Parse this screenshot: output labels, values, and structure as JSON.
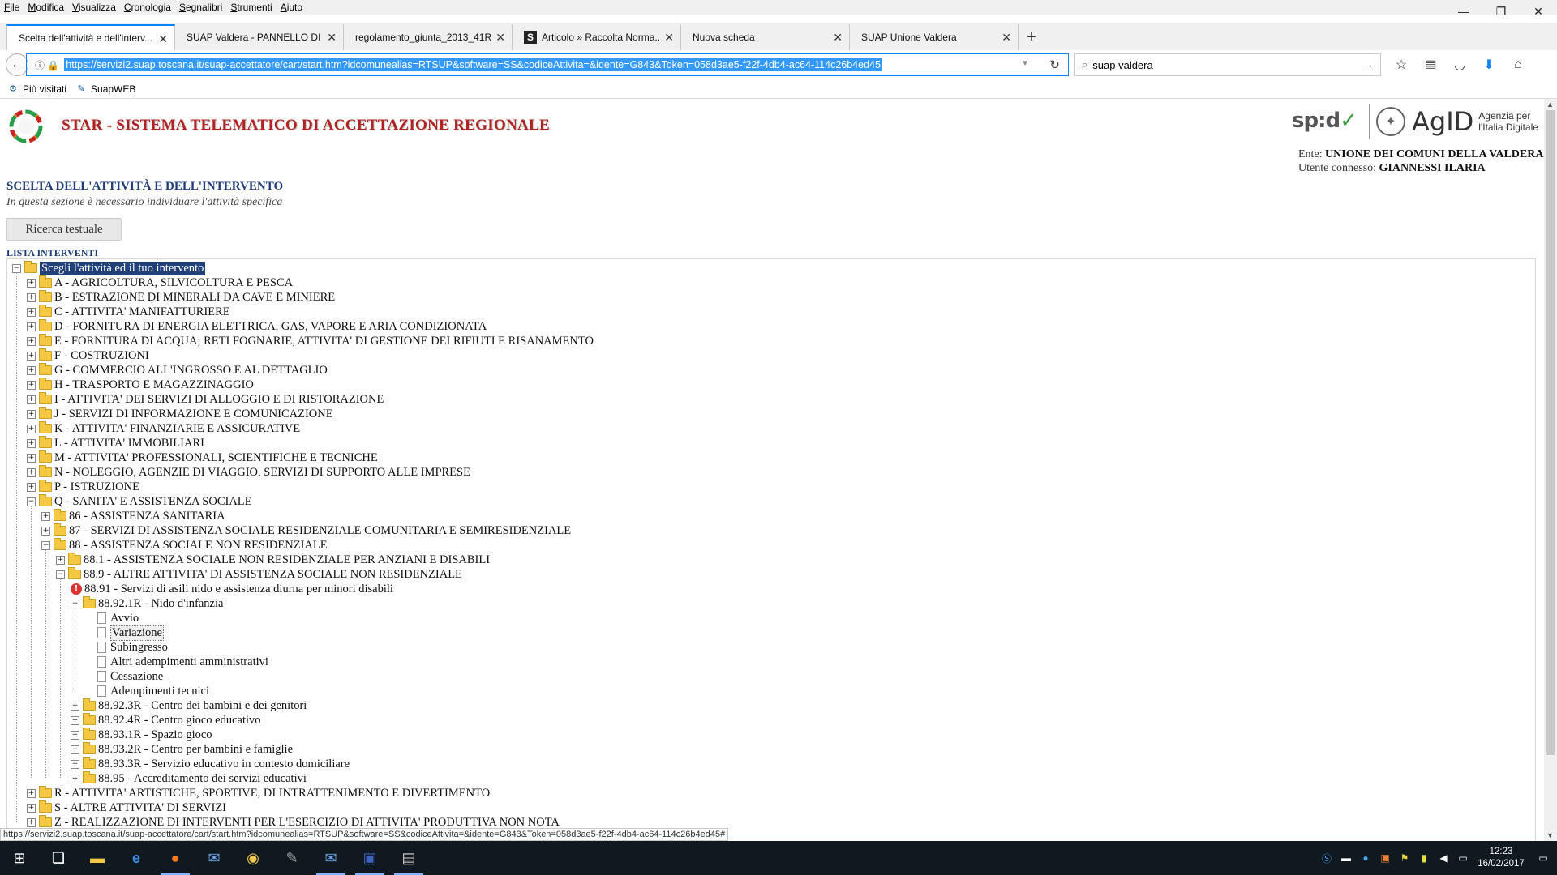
{
  "menubar": [
    "File",
    "Modifica",
    "Visualizza",
    "Cronologia",
    "Segnalibri",
    "Strumenti",
    "Aiuto"
  ],
  "window_controls": {
    "minimize": "—",
    "maximize": "❐",
    "close": "✕"
  },
  "tabs": [
    {
      "label": "Scelta dell'attività e dell'interv...",
      "active": true
    },
    {
      "label": "SUAP Valdera - PANNELLO DI ...",
      "active": false
    },
    {
      "label": "regolamento_giunta_2013_41R...",
      "active": false
    },
    {
      "label": "Articolo » Raccolta Norma...",
      "active": false,
      "favicon": "S"
    },
    {
      "label": "Nuova scheda",
      "active": false
    },
    {
      "label": "SUAP Unione Valdera",
      "active": false
    }
  ],
  "new_tab": "+",
  "url": "https://servizi2.suap.toscana.it/suap-accettatore/cart/start.htm?idcomunealias=RTSUP&software=SS&codiceAttivita=&idente=G843&Token=058d3ae5-f22f-4db4-ac64-114c26b4ed45",
  "search_value": "suap valdera",
  "bookmarks": [
    "Più visitati",
    "SuapWEB"
  ],
  "page": {
    "title": "STAR - SISTEMA TELEMATICO DI ACCETTAZIONE REGIONALE",
    "spid_logo": "sp:d",
    "agid_logo": "AgID",
    "agid_sub_1": "Agenzia per",
    "agid_sub_2": "l'Italia Digitale",
    "ente_label": "Ente:",
    "ente_value": "UNIONE DEI COMUNI DELLA VALDERA",
    "utente_label": "Utente connesso:",
    "utente_value": "GIANNESSI ILARIA",
    "section_title": "SCELTA DELL'ATTIVITÀ E DELL'INTERVENTO",
    "section_subtitle": "In questa sezione è necessario individuare l'attività specifica",
    "search_button": "Ricerca testuale",
    "lista_label": "LISTA INTERVENTI"
  },
  "tree": [
    {
      "label": "Scegli l'attività ed il tuo intervento",
      "level": 0,
      "type": "folder",
      "exp": "−",
      "selected": true
    },
    {
      "label": "A - AGRICOLTURA, SILVICOLTURA E PESCA",
      "level": 1,
      "type": "folder",
      "exp": "+"
    },
    {
      "label": "B - ESTRAZIONE DI MINERALI DA CAVE E MINIERE",
      "level": 1,
      "type": "folder",
      "exp": "+"
    },
    {
      "label": "C - ATTIVITA' MANIFATTURIERE",
      "level": 1,
      "type": "folder",
      "exp": "+"
    },
    {
      "label": "D - FORNITURA DI ENERGIA ELETTRICA, GAS, VAPORE E ARIA CONDIZIONATA",
      "level": 1,
      "type": "folder",
      "exp": "+"
    },
    {
      "label": "E - FORNITURA DI ACQUA; RETI FOGNARIE, ATTIVITA' DI GESTIONE DEI RIFIUTI E RISANAMENTO",
      "level": 1,
      "type": "folder",
      "exp": "+"
    },
    {
      "label": "F - COSTRUZIONI",
      "level": 1,
      "type": "folder",
      "exp": "+"
    },
    {
      "label": "G - COMMERCIO ALL'INGROSSO E AL DETTAGLIO",
      "level": 1,
      "type": "folder",
      "exp": "+"
    },
    {
      "label": "H - TRASPORTO E MAGAZZINAGGIO",
      "level": 1,
      "type": "folder",
      "exp": "+"
    },
    {
      "label": "I - ATTIVITA' DEI SERVIZI DI ALLOGGIO E DI RISTORAZIONE",
      "level": 1,
      "type": "folder",
      "exp": "+"
    },
    {
      "label": "J - SERVIZI DI INFORMAZIONE E COMUNICAZIONE",
      "level": 1,
      "type": "folder",
      "exp": "+"
    },
    {
      "label": "K - ATTIVITA' FINANZIARIE E ASSICURATIVE",
      "level": 1,
      "type": "folder",
      "exp": "+"
    },
    {
      "label": "L - ATTIVITA' IMMOBILIARI",
      "level": 1,
      "type": "folder",
      "exp": "+"
    },
    {
      "label": "M - ATTIVITA' PROFESSIONALI, SCIENTIFICHE E TECNICHE",
      "level": 1,
      "type": "folder",
      "exp": "+"
    },
    {
      "label": "N - NOLEGGIO, AGENZIE DI VIAGGIO, SERVIZI DI SUPPORTO ALLE IMPRESE",
      "level": 1,
      "type": "folder",
      "exp": "+"
    },
    {
      "label": "P - ISTRUZIONE",
      "level": 1,
      "type": "folder",
      "exp": "+"
    },
    {
      "label": "Q - SANITA' E ASSISTENZA SOCIALE",
      "level": 1,
      "type": "folder",
      "exp": "−"
    },
    {
      "label": "86 - ASSISTENZA SANITARIA",
      "level": 2,
      "type": "folder",
      "exp": "+"
    },
    {
      "label": "87 - SERVIZI DI ASSISTENZA SOCIALE RESIDENZIALE COMUNITARIA E SEMIRESIDENZIALE",
      "level": 2,
      "type": "folder",
      "exp": "+"
    },
    {
      "label": "88 - ASSISTENZA SOCIALE NON RESIDENZIALE",
      "level": 2,
      "type": "folder",
      "exp": "−"
    },
    {
      "label": "88.1 - ASSISTENZA SOCIALE NON RESIDENZIALE PER ANZIANI E DISABILI",
      "level": 3,
      "type": "folder",
      "exp": "+"
    },
    {
      "label": "88.9 - ALTRE ATTIVITA' DI ASSISTENZA SOCIALE NON RESIDENZIALE",
      "level": 3,
      "type": "folder",
      "exp": "−"
    },
    {
      "label": "88.91 - Servizi di asili nido e assistenza diurna per minori disabili",
      "level": 4,
      "type": "warn",
      "exp": ""
    },
    {
      "label": "88.92.1R - Nido d'infanzia",
      "level": 4,
      "type": "folder",
      "exp": "−"
    },
    {
      "label": "Avvio",
      "level": 5,
      "type": "doc",
      "exp": ""
    },
    {
      "label": "Variazione",
      "level": 5,
      "type": "doc",
      "exp": "",
      "focused": true
    },
    {
      "label": "Subingresso",
      "level": 5,
      "type": "doc",
      "exp": ""
    },
    {
      "label": "Altri adempimenti amministrativi",
      "level": 5,
      "type": "doc",
      "exp": ""
    },
    {
      "label": "Cessazione",
      "level": 5,
      "type": "doc",
      "exp": ""
    },
    {
      "label": "Adempimenti tecnici",
      "level": 5,
      "type": "doc",
      "exp": ""
    },
    {
      "label": "88.92.3R - Centro dei bambini e dei genitori",
      "level": 4,
      "type": "folder",
      "exp": "+"
    },
    {
      "label": "88.92.4R - Centro gioco educativo",
      "level": 4,
      "type": "folder",
      "exp": "+"
    },
    {
      "label": "88.93.1R - Spazio gioco",
      "level": 4,
      "type": "folder",
      "exp": "+"
    },
    {
      "label": "88.93.2R - Centro per bambini e famiglie",
      "level": 4,
      "type": "folder",
      "exp": "+"
    },
    {
      "label": "88.93.3R - Servizio educativo in contesto domiciliare",
      "level": 4,
      "type": "folder",
      "exp": "+"
    },
    {
      "label": "88.95 - Accreditamento dei servizi educativi",
      "level": 4,
      "type": "folder",
      "exp": "+"
    },
    {
      "label": "R - ATTIVITA' ARTISTICHE, SPORTIVE, DI INTRATTENIMENTO E DIVERTIMENTO",
      "level": 1,
      "type": "folder",
      "exp": "+"
    },
    {
      "label": "S - ALTRE ATTIVITA' DI SERVIZI",
      "level": 1,
      "type": "folder",
      "exp": "+"
    },
    {
      "label": "Z - REALIZZAZIONE DI INTERVENTI PER L'ESERCIZIO DI ATTIVITA' PRODUTTIVA NON NOTA",
      "level": 1,
      "type": "folder",
      "exp": "+"
    }
  ],
  "status_url": "https://servizi2.suap.toscana.it/suap-accettatore/cart/start.htm?idcomunealias=RTSUP&software=SS&codiceAttivita=&idente=G843&Token=058d3ae5-f22f-4db4-ac64-114c26b4ed45#",
  "clock": {
    "time": "12:23",
    "date": "16/02/2017"
  }
}
